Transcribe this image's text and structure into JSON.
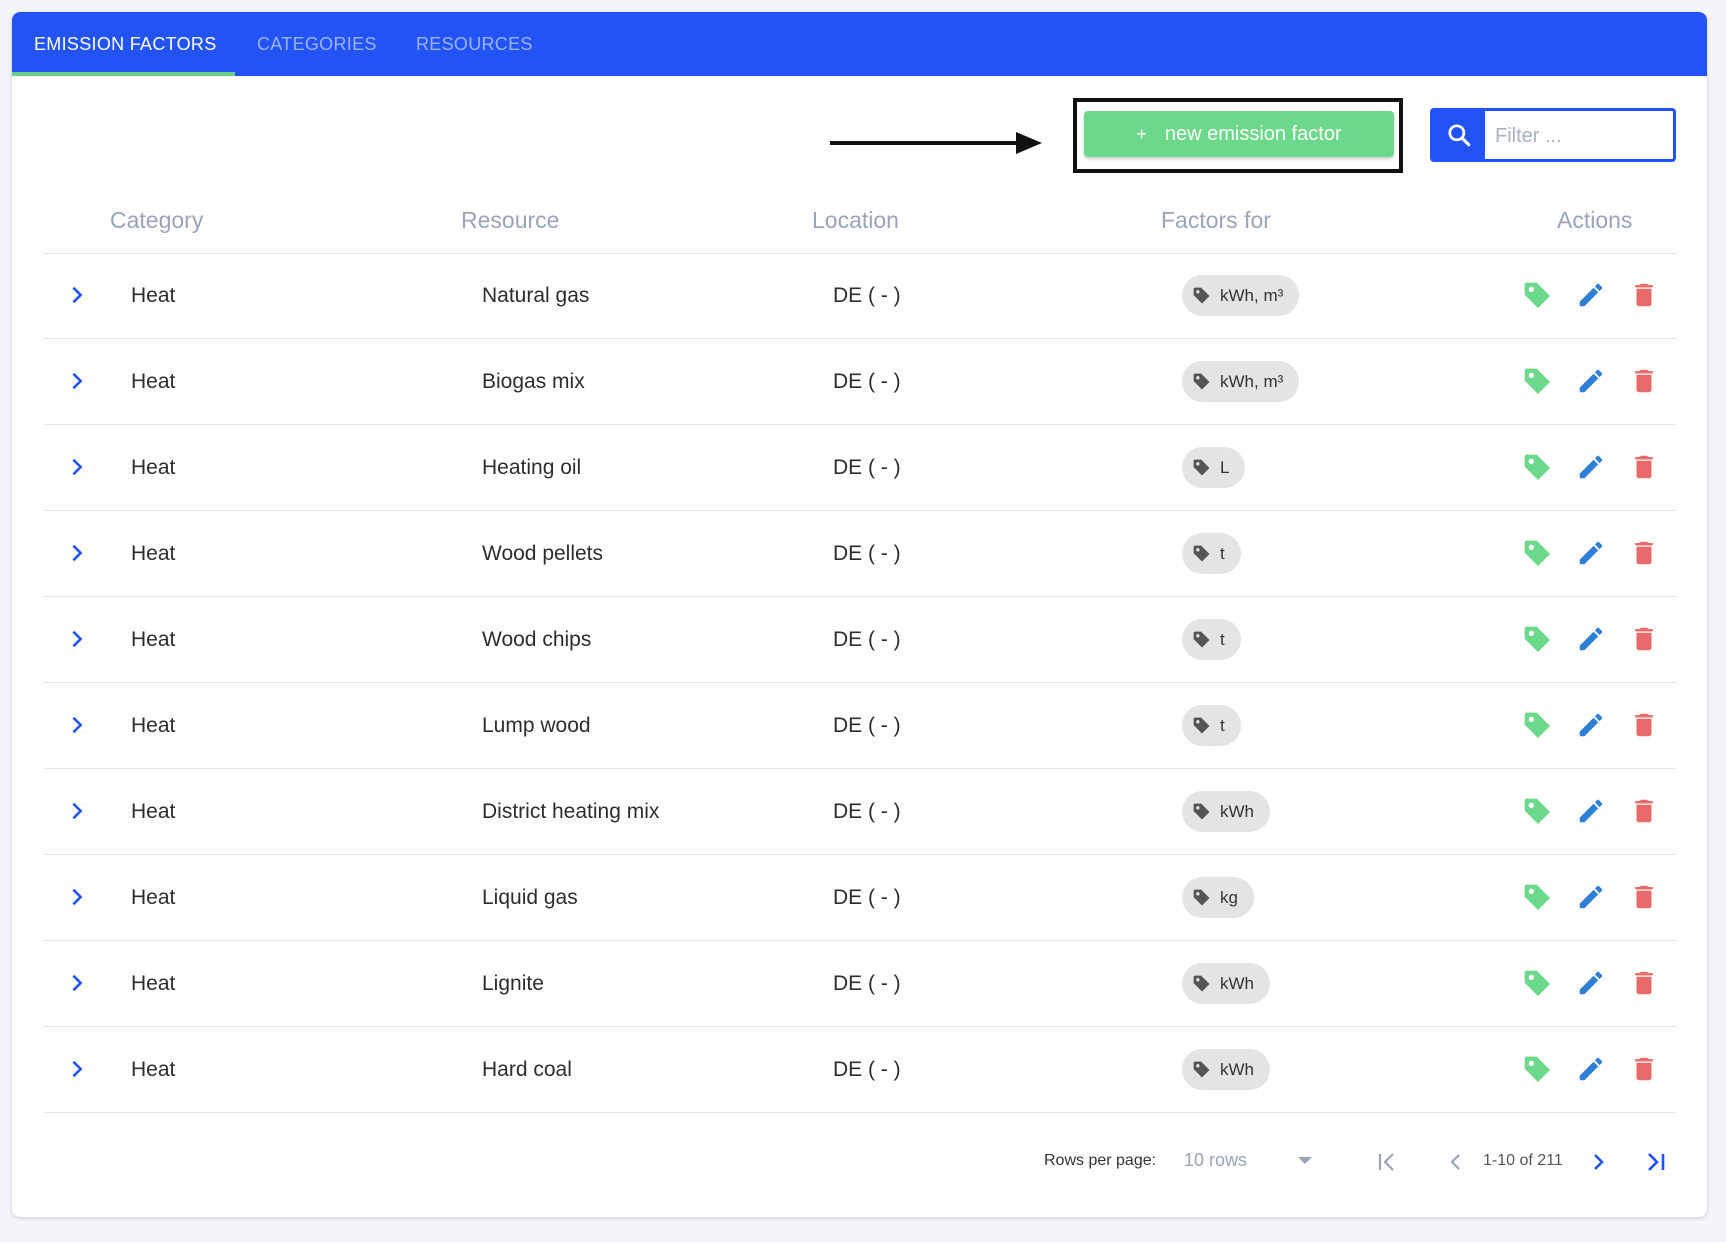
{
  "tabs": [
    {
      "label": "EMISSION FACTORS",
      "active": true
    },
    {
      "label": "CATEGORIES",
      "active": false
    },
    {
      "label": "RESOURCES",
      "active": false
    }
  ],
  "toolbar": {
    "new_button_icon": "+",
    "new_button_label": "new emission factor",
    "filter_placeholder": "Filter ..."
  },
  "table": {
    "headers": {
      "category": "Category",
      "resource": "Resource",
      "location": "Location",
      "factors_for": "Factors for",
      "actions": "Actions"
    },
    "rows": [
      {
        "category": "Heat",
        "resource": "Natural gas",
        "location": "DE ( - )",
        "factors": "kWh, m³"
      },
      {
        "category": "Heat",
        "resource": "Biogas mix",
        "location": "DE ( - )",
        "factors": "kWh, m³"
      },
      {
        "category": "Heat",
        "resource": "Heating oil",
        "location": "DE ( - )",
        "factors": "L"
      },
      {
        "category": "Heat",
        "resource": "Wood pellets",
        "location": "DE ( - )",
        "factors": "t"
      },
      {
        "category": "Heat",
        "resource": "Wood chips",
        "location": "DE ( - )",
        "factors": "t"
      },
      {
        "category": "Heat",
        "resource": "Lump wood",
        "location": "DE ( - )",
        "factors": "t"
      },
      {
        "category": "Heat",
        "resource": "District heating mix",
        "location": "DE ( - )",
        "factors": "kWh"
      },
      {
        "category": "Heat",
        "resource": "Liquid gas",
        "location": "DE ( - )",
        "factors": "kg"
      },
      {
        "category": "Heat",
        "resource": "Lignite",
        "location": "DE ( - )",
        "factors": "kWh"
      },
      {
        "category": "Heat",
        "resource": "Hard coal",
        "location": "DE ( - )",
        "factors": "kWh"
      }
    ]
  },
  "pagination": {
    "rows_per_page_label": "Rows per page:",
    "rows_per_page_value": "10 rows",
    "range": "1-10 of 211"
  },
  "colors": {
    "primary": "#2253f5",
    "success": "#6bd88a",
    "edit": "#2e7fd6",
    "delete": "#e96a6a",
    "chip": "#e4e4e6"
  },
  "icons": [
    "search-icon",
    "chevron-right-icon",
    "tag-icon",
    "edit-icon",
    "trash-icon",
    "first-page-icon",
    "prev-page-icon",
    "next-page-icon",
    "last-page-icon",
    "arrow-right-icon"
  ]
}
